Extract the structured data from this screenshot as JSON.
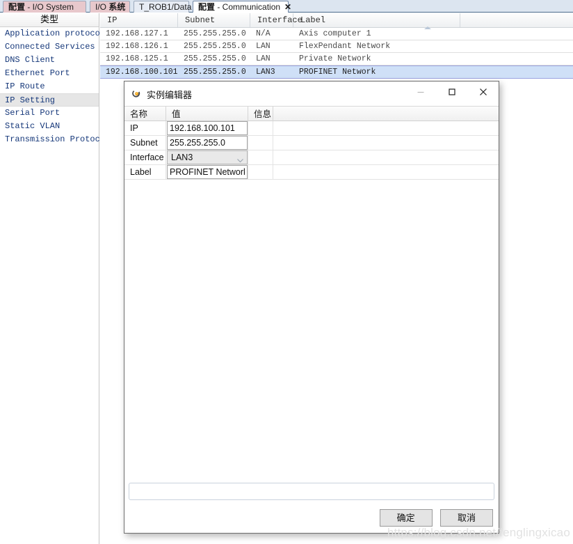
{
  "tabs": [
    {
      "label": "配置 - I/O System",
      "cn_prefix": "配置",
      "rest": " - I/O System",
      "active": false,
      "closable": false,
      "style": "pink"
    },
    {
      "label": "I/O 系统",
      "cn_prefix": "I/O ",
      "rest": "系统",
      "active": false,
      "closable": false,
      "style": "pink"
    },
    {
      "label": "T_ROB1/Data",
      "cn_prefix": "",
      "rest": "T_ROB1/Data",
      "active": false,
      "closable": false,
      "style": "plain"
    },
    {
      "label": "配置 - Communication",
      "cn_prefix": "配置",
      "rest": " - Communication",
      "active": true,
      "closable": true,
      "close_glyph": "✕",
      "style": "active"
    }
  ],
  "sidebar": {
    "header": "类型",
    "items": [
      {
        "label": "Application protocol",
        "selected": false
      },
      {
        "label": "Connected Services",
        "selected": false
      },
      {
        "label": "DNS Client",
        "selected": false
      },
      {
        "label": "Ethernet Port",
        "selected": false
      },
      {
        "label": "IP Route",
        "selected": false
      },
      {
        "label": "IP Setting",
        "selected": true
      },
      {
        "label": "Serial Port",
        "selected": false
      },
      {
        "label": "Static VLAN",
        "selected": false
      },
      {
        "label": "Transmission Protocol",
        "selected": false
      }
    ]
  },
  "grid": {
    "columns": [
      {
        "key": "ip",
        "label": "IP",
        "sorted": false
      },
      {
        "key": "subnet",
        "label": "Subnet",
        "sorted": false
      },
      {
        "key": "interface",
        "label": "Interface",
        "sorted": false
      },
      {
        "key": "label",
        "label": "Label",
        "sorted": true,
        "sort_dir": "asc"
      }
    ],
    "rows": [
      {
        "ip": "192.168.127.1",
        "subnet": "255.255.255.0",
        "interface": "N/A",
        "label": "Axis computer 1",
        "selected": false
      },
      {
        "ip": "192.168.126.1",
        "subnet": "255.255.255.0",
        "interface": "LAN",
        "label": "FlexPendant Network",
        "selected": false
      },
      {
        "ip": "192.168.125.1",
        "subnet": "255.255.255.0",
        "interface": "LAN",
        "label": "Private Network",
        "selected": false
      },
      {
        "ip": "192.168.100.101",
        "subnet": "255.255.255.0",
        "interface": "LAN3",
        "label": "PROFINET Network",
        "selected": true
      }
    ]
  },
  "dialog": {
    "title": "实例编辑器",
    "window_buttons": {
      "minimize": "—",
      "maximize": "□",
      "close": "✕"
    },
    "columns": [
      {
        "key": "name",
        "label": "名称"
      },
      {
        "key": "value",
        "label": "值"
      },
      {
        "key": "info",
        "label": "信息"
      },
      {
        "key": "rest",
        "label": ""
      }
    ],
    "rows": [
      {
        "name": "IP",
        "value": "192.168.100.101",
        "control": "text",
        "info": ""
      },
      {
        "name": "Subnet",
        "value": "255.255.255.0",
        "control": "text",
        "info": ""
      },
      {
        "name": "Interface",
        "value": "LAN3",
        "control": "combo",
        "info": ""
      },
      {
        "name": "Label",
        "value": "PROFINET Network",
        "control": "text",
        "info": ""
      }
    ],
    "description_value": "",
    "buttons": {
      "ok": "确定",
      "cancel": "取消"
    }
  },
  "watermark": "https://blog.csdn.net/fenglingxicao",
  "colors": {
    "tab_bar_bg": "#dce5f0",
    "tab_pink": "#e8c8cc",
    "tab_active": "#ffffff",
    "selected_row": "#cfe0f7",
    "sidebar_text": "#16387a",
    "sidebar_selected": "#e6e6e6",
    "dialog_border": "#6d6d6d",
    "button_face": "#e4e4e4"
  }
}
